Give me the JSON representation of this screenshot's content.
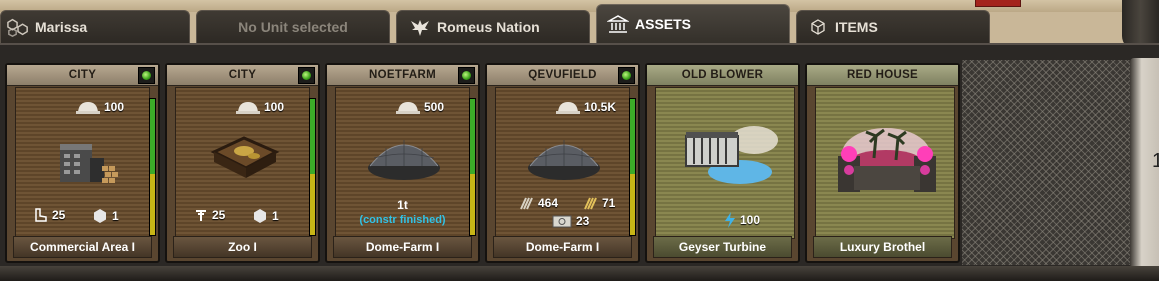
{
  "tabs": [
    {
      "label": "Marissa",
      "icon": "hexagons-icon",
      "active": false
    },
    {
      "label": "No Unit selected",
      "active": false
    },
    {
      "label": "Romeus Nation",
      "icon": "eagle-emblem-icon",
      "active": false
    },
    {
      "label": "ASSETS",
      "icon": "building-icon",
      "active": true
    },
    {
      "label": "ITEMS",
      "icon": "cube-icon",
      "active": false
    }
  ],
  "cards": [
    {
      "header": "CITY",
      "name": "Commercial Area I",
      "top_value": "100",
      "stats": [
        "25",
        "1"
      ]
    },
    {
      "header": "CITY",
      "name": "Zoo I",
      "top_value": "100",
      "stats": [
        "25",
        "1"
      ]
    },
    {
      "header": "NOETFARM",
      "name": "Dome-Farm I",
      "top_value": "500",
      "line1": "1t",
      "note": "(constr finished)",
      "note_color": "#31c2e6"
    },
    {
      "header": "QEVUFIELD",
      "name": "Dome-Farm I",
      "top_value": "10.5K",
      "stats": [
        "464",
        "71",
        "23"
      ]
    },
    {
      "header": "OLD BLOWER",
      "name": "Geyser Turbine",
      "stats": [
        "100"
      ]
    },
    {
      "header": "RED HOUSE",
      "name": "Luxury Brothel"
    }
  ],
  "side_panel": {
    "char": "1"
  }
}
